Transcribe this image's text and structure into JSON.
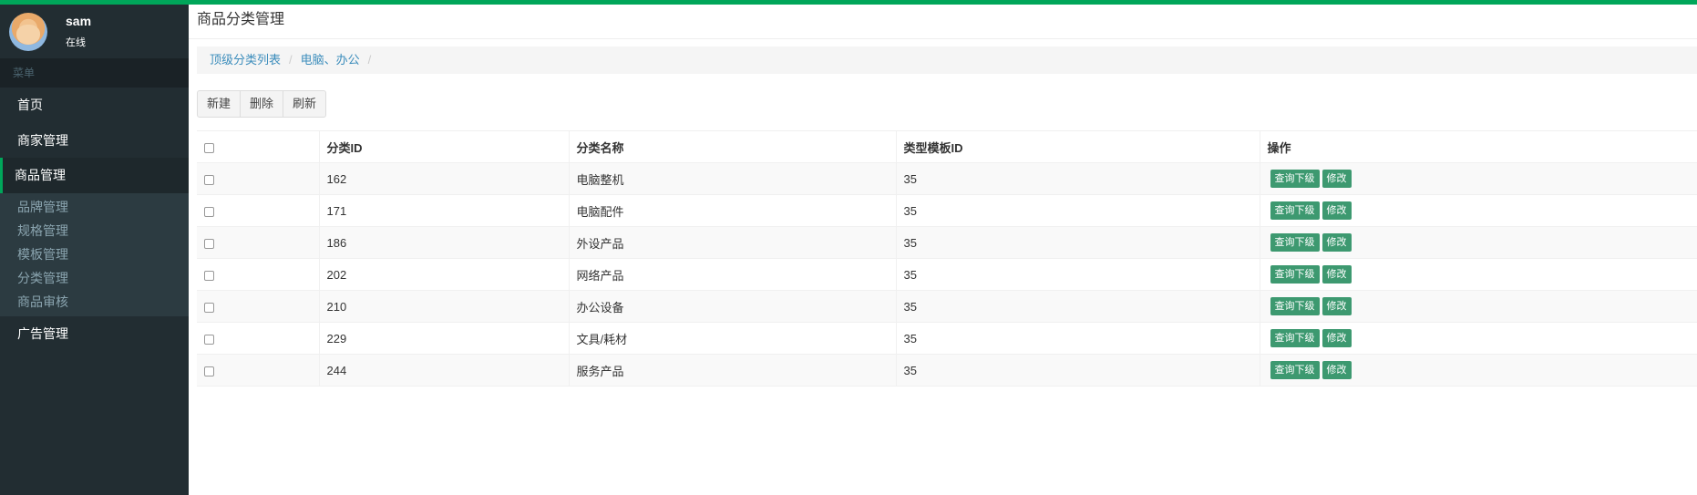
{
  "colors": {
    "accent": "#00a65a",
    "sidebar_bg": "#222d32",
    "link": "#3c8dbc",
    "action_btn": "#3d9970"
  },
  "user": {
    "name": "sam",
    "status": "在线"
  },
  "sidebar": {
    "header": "菜单",
    "items": [
      {
        "label": "首页"
      },
      {
        "label": "商家管理"
      },
      {
        "label": "商品管理",
        "active": true
      },
      {
        "label": "广告管理"
      }
    ],
    "submenu": [
      {
        "label": "品牌管理"
      },
      {
        "label": "规格管理"
      },
      {
        "label": "模板管理"
      },
      {
        "label": "分类管理"
      },
      {
        "label": "商品审核"
      }
    ]
  },
  "page": {
    "title": "商品分类管理",
    "breadcrumb": [
      "顶级分类列表",
      "电脑、办公"
    ]
  },
  "toolbar": {
    "new_label": "新建",
    "delete_label": "删除",
    "refresh_label": "刷新"
  },
  "table": {
    "columns": [
      "分类ID",
      "分类名称",
      "类型模板ID",
      "操作"
    ],
    "rows": [
      {
        "id": "162",
        "name": "电脑整机",
        "template": "35"
      },
      {
        "id": "171",
        "name": "电脑配件",
        "template": "35"
      },
      {
        "id": "186",
        "name": "外设产品",
        "template": "35"
      },
      {
        "id": "202",
        "name": "网络产品",
        "template": "35"
      },
      {
        "id": "210",
        "name": "办公设备",
        "template": "35"
      },
      {
        "id": "229",
        "name": "文具/耗材",
        "template": "35"
      },
      {
        "id": "244",
        "name": "服务产品",
        "template": "35"
      }
    ],
    "query_label": "查询下级",
    "edit_label": "修改"
  }
}
